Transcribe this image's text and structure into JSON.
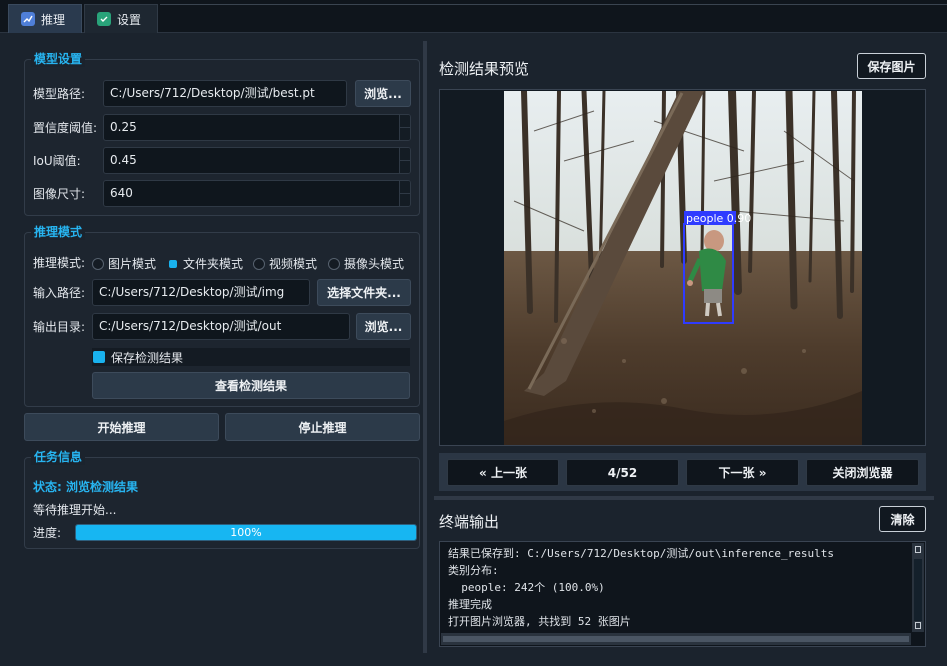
{
  "tabs": [
    {
      "label": "推理",
      "icon": "chart-icon",
      "active": true
    },
    {
      "label": "设置",
      "icon": "check-icon",
      "active": false
    }
  ],
  "model_settings": {
    "title": "模型设置",
    "model_path_label": "模型路径:",
    "model_path_value": "C:/Users/712/Desktop/测试/best.pt",
    "browse_label": "浏览...",
    "confidence_label": "置信度阈值:",
    "confidence_value": "0.25",
    "iou_label": "IoU阈值:",
    "iou_value": "0.45",
    "image_size_label": "图像尺寸:",
    "image_size_value": "640"
  },
  "inference_mode": {
    "title": "推理模式",
    "mode_label": "推理模式:",
    "modes": [
      {
        "label": "图片模式",
        "checked": false
      },
      {
        "label": "文件夹模式",
        "checked": true
      },
      {
        "label": "视频模式",
        "checked": false
      },
      {
        "label": "摄像头模式",
        "checked": false
      }
    ],
    "input_label": "输入路径:",
    "input_value": "C:/Users/712/Desktop/测试/img",
    "select_folder_label": "选择文件夹...",
    "output_label": "输出目录:",
    "output_value": "C:/Users/712/Desktop/测试/out",
    "output_browse_label": "浏览...",
    "save_results_label": "保存检测结果",
    "save_results_checked": true,
    "view_results_label": "查看检测结果"
  },
  "actions": {
    "start_label": "开始推理",
    "stop_label": "停止推理"
  },
  "task_info": {
    "title": "任务信息",
    "status_text": "状态: 浏览检测结果",
    "wait_text": "等待推理开始...",
    "progress_label": "进度:",
    "progress_value": 1.0,
    "progress_text": "100%"
  },
  "preview": {
    "title": "检测结果预览",
    "save_image_label": "保存图片",
    "detection_label": "people 0.90",
    "prev_label": "« 上一张",
    "counter": "4/52",
    "next_label": "下一张 »",
    "close_label": "关闭浏览器"
  },
  "terminal": {
    "title": "终端输出",
    "clear_label": "清除",
    "lines": [
      "结果已保存到: C:/Users/712/Desktop/测试/out\\inference_results",
      "类别分布:",
      "  people: 242个 (100.0%)",
      "推理完成",
      "打开图片浏览器, 共找到 52 张图片"
    ]
  },
  "colors": {
    "accent": "#19b2ee",
    "box": "#2f3bff",
    "background": "#1b232d"
  }
}
